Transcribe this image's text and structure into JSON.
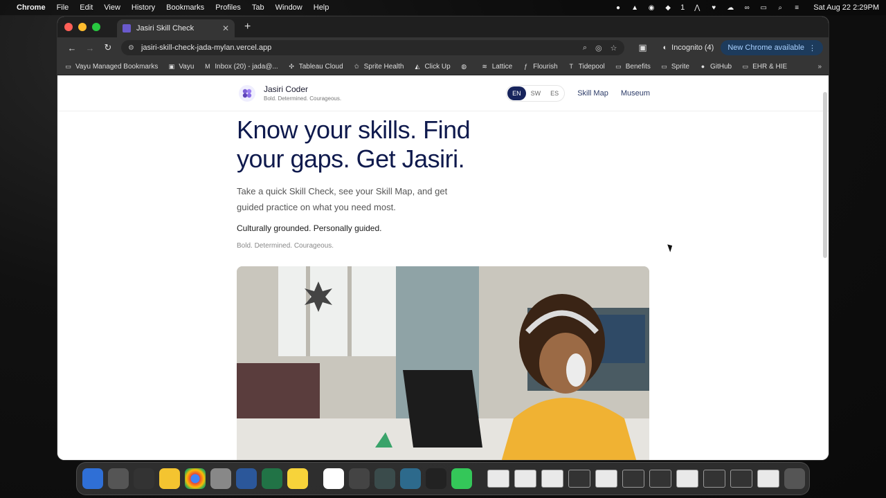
{
  "menubar": {
    "app": "Chrome",
    "items": [
      "File",
      "Edit",
      "View",
      "History",
      "Bookmarks",
      "Profiles",
      "Tab",
      "Window",
      "Help"
    ],
    "status_number": "1",
    "clock": "Sat Aug 22  2:29PM"
  },
  "browser": {
    "tab_title": "Jasiri Skill Check",
    "url": "jasiri-skill-check-jada-mylan.vercel.app",
    "incognito": "Incognito (4)",
    "update": "New Chrome available"
  },
  "bookmarks": [
    {
      "label": "Vayu Managed Bookmarks",
      "icon": "folder-icon"
    },
    {
      "label": "Vayu",
      "icon": "image-icon"
    },
    {
      "label": "Inbox (20) - jada@...",
      "icon": "gmail-icon"
    },
    {
      "label": "Tableau Cloud",
      "icon": "tableau-icon"
    },
    {
      "label": "Sprite Health",
      "icon": "star-icon"
    },
    {
      "label": "Click Up",
      "icon": "clickup-icon"
    },
    {
      "label": "",
      "icon": "globe-icon"
    },
    {
      "label": "Lattice",
      "icon": "lattice-icon"
    },
    {
      "label": "Flourish",
      "icon": "flourish-icon"
    },
    {
      "label": "Tidepool",
      "icon": "tidepool-icon"
    },
    {
      "label": "Benefits",
      "icon": "folder-icon"
    },
    {
      "label": "Sprite",
      "icon": "folder-icon"
    },
    {
      "label": "GitHub",
      "icon": "github-icon"
    },
    {
      "label": "EHR & HIE",
      "icon": "folder-icon"
    }
  ],
  "site": {
    "brand_name": "Jasiri Coder",
    "brand_tagline": "Bold. Determined. Courageous.",
    "languages": [
      "EN",
      "SW",
      "ES"
    ],
    "active_language": "EN",
    "nav": [
      "Skill Map",
      "Museum"
    ]
  },
  "hero": {
    "headline": "Know your skills. Find your gaps. Get Jasiri.",
    "subtitle": "Take a quick Skill Check, see your Skill Map, and get guided practice on what you need most.",
    "emphasis": "Culturally grounded. Personally guided.",
    "tagline": "Bold. Determined. Courageous."
  },
  "colors": {
    "accent": "#17245c",
    "headline": "#0f1a4d"
  }
}
